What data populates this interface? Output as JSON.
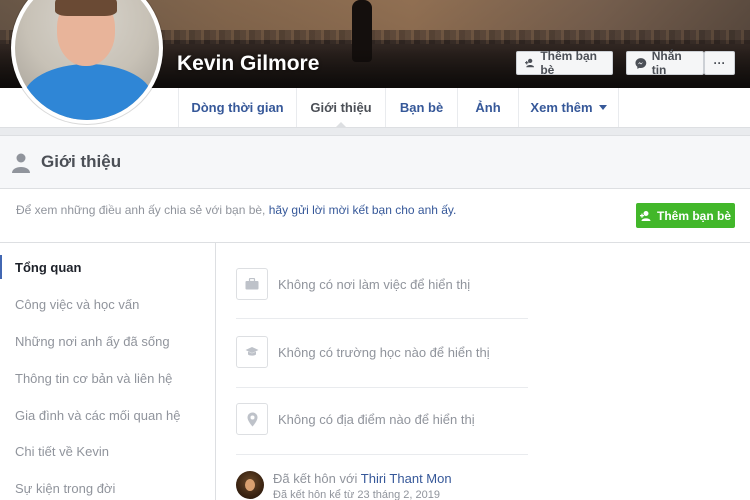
{
  "profile": {
    "name": "Kevin Gilmore"
  },
  "cover_buttons": {
    "add_friend": "Thêm bạn bè",
    "message": "Nhắn tin",
    "more": "···"
  },
  "nav": {
    "items": [
      {
        "label": "Dòng thời gian"
      },
      {
        "label": "Giới thiệu"
      },
      {
        "label": "Bạn bè"
      },
      {
        "label": "Ảnh"
      },
      {
        "label": "Xem thêm"
      }
    ],
    "active": "Giới thiệu"
  },
  "about": {
    "title": "Giới thiệu",
    "notice_prefix": "Để xem những điều anh ấy chia sẻ với bạn bè, ",
    "notice_link": "hãy gửi lời mời kết bạn cho anh ấy.",
    "add_friend": "Thêm bạn bè",
    "sidebar": [
      {
        "label": "Tổng quan"
      },
      {
        "label": "Công việc và học vấn"
      },
      {
        "label": "Những nơi anh ấy đã sống"
      },
      {
        "label": "Thông tin cơ bản và liên hệ"
      },
      {
        "label": "Gia đình và các mối quan hệ"
      },
      {
        "label": "Chi tiết về Kevin"
      },
      {
        "label": "Sự kiện trong đời"
      }
    ],
    "overview": [
      {
        "text": "Không có nơi làm việc để hiển thị",
        "icon": "briefcase-icon"
      },
      {
        "text": "Không có trường học nào để hiển thị",
        "icon": "graduation-cap-icon"
      },
      {
        "text": "Không có địa điểm nào để hiển thị",
        "icon": "location-pin-icon"
      }
    ],
    "relationship": {
      "prefix": "Đã kết hôn với ",
      "partner": "Thiri Thant Mon",
      "date": "Đã kết hôn kể từ 23 tháng 2, 2019"
    }
  },
  "colors": {
    "link": "#365899",
    "green": "#42b72a",
    "muted": "#90949c",
    "active_bar": "#4267b2"
  }
}
